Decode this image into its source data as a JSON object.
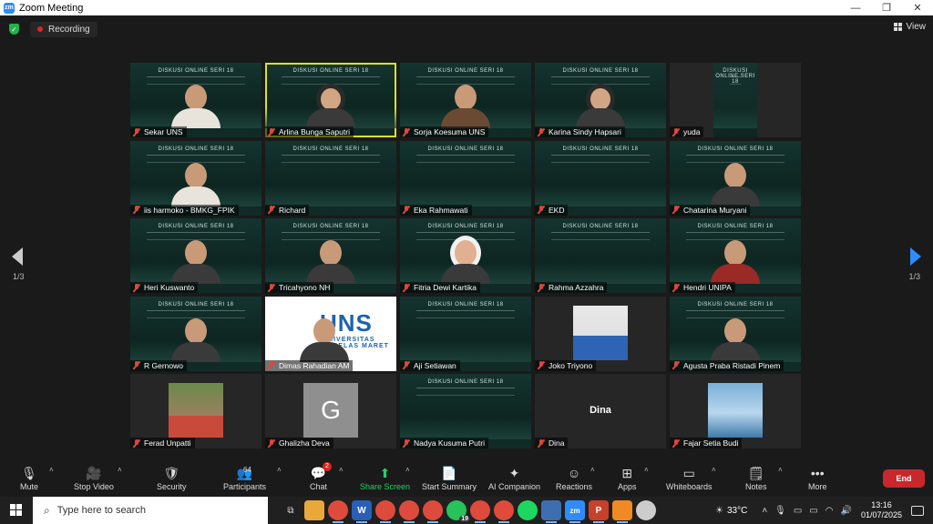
{
  "window": {
    "title": "Zoom Meeting",
    "minimize": "—",
    "restore": "❐",
    "close": "✕"
  },
  "status": {
    "recording_label": "Recording",
    "view_label": "View"
  },
  "pager": {
    "left_label": "1/3",
    "right_label": "1/3"
  },
  "slide": {
    "heading": "DISKUSI ONLINE SERI 18"
  },
  "participants": [
    {
      "name": "Sekar UNS",
      "kind": "slide-person",
      "style": "light"
    },
    {
      "name": "Arlina Bunga Saputri",
      "kind": "slide-person",
      "style": "hijab",
      "active": true
    },
    {
      "name": "Sorja Koesuma UNS",
      "kind": "slide-person",
      "style": "brown"
    },
    {
      "name": "Karina Sindy Hapsari",
      "kind": "slide-person",
      "style": "hijab"
    },
    {
      "name": "yuda",
      "kind": "slide-narrow"
    },
    {
      "name": "iis harmoko - BMKG_FPIK",
      "kind": "slide-person",
      "style": "light"
    },
    {
      "name": "Richard",
      "kind": "slide"
    },
    {
      "name": "Eka Rahmawati",
      "kind": "slide"
    },
    {
      "name": "EKD",
      "kind": "slide"
    },
    {
      "name": "Chatarina Muryani",
      "kind": "slide-person",
      "style": "dark"
    },
    {
      "name": "Heri Kuswanto",
      "kind": "slide-person",
      "style": "dark"
    },
    {
      "name": "Tricahyono NH",
      "kind": "slide-person",
      "style": "dark"
    },
    {
      "name": "Fitria Dewi Kartika",
      "kind": "slide-person",
      "style": "white-hijab"
    },
    {
      "name": "Rahma Azzahra",
      "kind": "slide"
    },
    {
      "name": "Hendri UNIPA",
      "kind": "slide-person",
      "style": "red"
    },
    {
      "name": "R Gernowo",
      "kind": "slide-person",
      "style": "dark"
    },
    {
      "name": "Dimas Rahadian AM",
      "kind": "uns"
    },
    {
      "name": "Aji Setiawan",
      "kind": "slide"
    },
    {
      "name": "Joko Triyono",
      "kind": "photo-blue"
    },
    {
      "name": "Agusta Praba Ristadi Pinem",
      "kind": "slide-person",
      "style": "dark"
    },
    {
      "name": "Ferad Unpatti",
      "kind": "photo-outdoor"
    },
    {
      "name": "Ghalizha Deva",
      "kind": "avatar",
      "initial": "G"
    },
    {
      "name": "Nadya Kusuma Putri",
      "kind": "slide"
    },
    {
      "name": "Dina",
      "kind": "name-only",
      "display": "Dina"
    },
    {
      "name": "Fajar Setia Budi",
      "kind": "photo-art"
    }
  ],
  "uns_logo": {
    "big": "UNS",
    "small": "UNIVERSITAS SEBELAS MARET"
  },
  "toolbar": {
    "mute": "Mute",
    "stop_video": "Stop Video",
    "security": "Security",
    "participants": "Participants",
    "participants_count": "64",
    "chat": "Chat",
    "chat_badge": "2",
    "share_screen": "Share Screen",
    "start_summary": "Start Summary",
    "ai_companion": "AI Companion",
    "reactions": "Reactions",
    "apps": "Apps",
    "whiteboards": "Whiteboards",
    "notes": "Notes",
    "more": "More",
    "end": "End"
  },
  "taskbar": {
    "search_placeholder": "Type here to search",
    "whatsapp_badge": "19",
    "temperature": "33°C",
    "time": "13:16",
    "date": "01/07/2025"
  },
  "colors": {
    "accent": "#2d8cff",
    "active_speaker": "#d7e22e",
    "end": "#c8282b",
    "share": "#23d160"
  }
}
